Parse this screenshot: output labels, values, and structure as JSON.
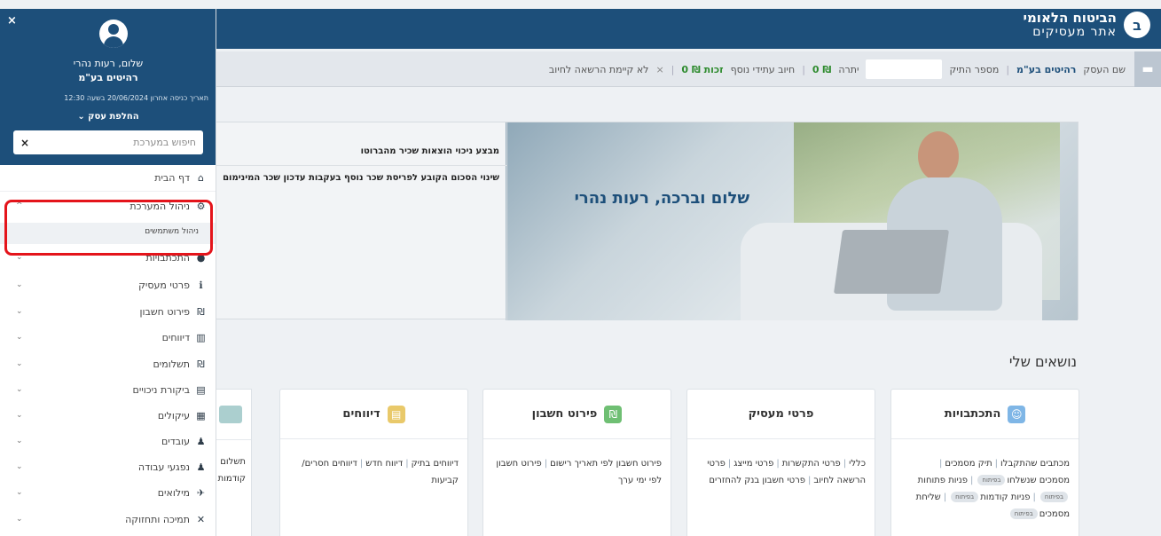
{
  "header": {
    "brand_title": "הביטוח הלאומי",
    "brand_sub": "אתר מעסיקים",
    "logo_glyph": "ב"
  },
  "infobar": {
    "business_label": "שם העסק",
    "business_value": "רהיטים בע\"מ",
    "file_label": "מספר התיק",
    "balance_label": "יתרה",
    "balance_value": "0 ₪",
    "future_label": "חיוב עתידי נוסף",
    "future_value": "0 ₪ זכות",
    "auth_value": "לא קיימת הרשאה לחיוב",
    "close_glyph": "×",
    "accent_green": "#2e8b2e"
  },
  "hero": {
    "greeting": "שלום וברכה, רעות נהרי",
    "news": [
      "מבצע ניכוי הוצאות שכיר מהברוטו",
      "שינוי הסכום הקובע לפריסת שכר נוסף בעקבות עדכון שכר המינימום"
    ]
  },
  "topics": {
    "title": "נושאים שלי"
  },
  "cards": [
    {
      "title": "התכתבויות",
      "icon": "chat-icon",
      "lines": [
        {
          "text": "מכתבים שהתקבלו",
          "pill": ""
        },
        {
          "text": "תיק מסמכים",
          "pill": ""
        },
        {
          "text": "מסמכים שנשלחו",
          "pill": "בפיתוח"
        },
        {
          "text": "פניות פתוחות",
          "pill": "בפיתוח"
        },
        {
          "text": "פניות קודמות",
          "pill": "בפיתוח"
        },
        {
          "text": "שליחת מסמכים",
          "pill": "בפיתוח"
        }
      ]
    },
    {
      "title": "פרטי מעסיק",
      "icon": "",
      "links": [
        "כללי",
        "פרטי התקשרות",
        "פרטי מייצג",
        "פרטי הרשאה לחיוב",
        "פרטי חשבון בנק להחזרים"
      ]
    },
    {
      "title": "פירוט חשבון",
      "icon": "shekel-icon",
      "links": [
        "פירוט חשבון לפי תאריך רישום",
        "פירוט חשבון לפי ימי ערך"
      ]
    },
    {
      "title": "דיווחים",
      "icon": "report-icon",
      "links": [
        "דיווחים בתיק",
        "דיווח חדש",
        "דיווחים חסרים/ קביעות"
      ]
    }
  ],
  "partial_card": {
    "text": "תשלום קודמות"
  },
  "sidebar": {
    "close_glyph": "×",
    "hello": "שלום, רעות נהרי",
    "company": "רהיטים בע\"מ",
    "last_login": "תאריך כניסה אחרון 20/06/2024 בשעה 12:30",
    "switch_business": "החלפת עסק ⌄",
    "search_placeholder": "חיפוש במערכת",
    "search_clear": "×",
    "items": [
      {
        "label": "דף הבית",
        "icon": "⌂",
        "chev": ""
      },
      {
        "label": "ניהול המערכת",
        "icon": "⚙",
        "chev": "^"
      },
      {
        "label": "התכתבויות",
        "icon": "●",
        "chev": "⌄"
      },
      {
        "label": "פרטי מעסיק",
        "icon": "ℹ",
        "chev": "⌄"
      },
      {
        "label": "פירוט חשבון",
        "icon": "₪",
        "chev": "⌄"
      },
      {
        "label": "דיווחים",
        "icon": "▥",
        "chev": "⌄"
      },
      {
        "label": "תשלומים",
        "icon": "₪",
        "chev": "⌄"
      },
      {
        "label": "ביקורת ניכויים",
        "icon": "▤",
        "chev": "⌄"
      },
      {
        "label": "עיקולים",
        "icon": "▦",
        "chev": "⌄"
      },
      {
        "label": "עובדים",
        "icon": "♟",
        "chev": "⌄"
      },
      {
        "label": "נפגעי עבודה",
        "icon": "♟",
        "chev": "⌄"
      },
      {
        "label": "מילואים",
        "icon": "✈",
        "chev": "⌄"
      },
      {
        "label": "תמיכה ותחזוקה",
        "icon": "✕",
        "chev": "⌄"
      }
    ],
    "sub_item": "ניהול משתמשים",
    "highlight_color": "#e4141b"
  }
}
